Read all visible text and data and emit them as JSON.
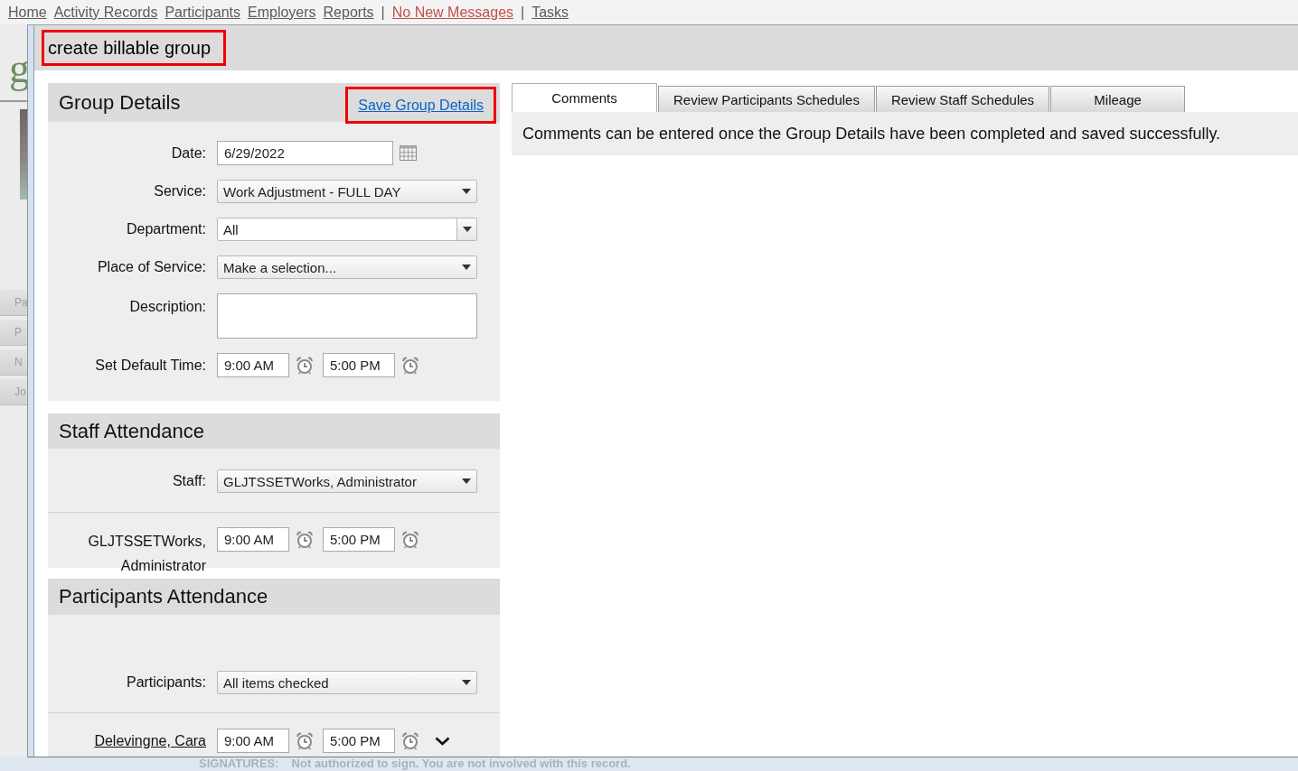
{
  "top_nav": {
    "items": [
      {
        "label": "Home",
        "kind": "link"
      },
      {
        "label": "Activity Records",
        "kind": "link"
      },
      {
        "label": "Participants",
        "kind": "link"
      },
      {
        "label": "Employers",
        "kind": "link"
      },
      {
        "label": "Reports",
        "kind": "link"
      },
      {
        "label": "|",
        "kind": "separator"
      },
      {
        "label": "No New Messages",
        "kind": "alert"
      },
      {
        "label": "|",
        "kind": "separator"
      },
      {
        "label": "Tasks",
        "kind": "link"
      }
    ]
  },
  "background": {
    "logo_fragment": "g",
    "row_fragments": [
      "Pa",
      "P",
      "N",
      "Jo"
    ],
    "signatures": {
      "label": "SIGNATURES:",
      "message": "Not authorized to sign. You are not involved with this record."
    }
  },
  "dialog": {
    "title": "create billable group",
    "title_highlighted": true,
    "group_details": {
      "title": "Group Details",
      "save_link": {
        "label": "Save Group Details",
        "highlighted": true
      },
      "fields": [
        {
          "kind": "date",
          "label": "Date:",
          "value": "6/29/2022"
        },
        {
          "kind": "select",
          "label": "Service:",
          "value": "Work Adjustment - FULL DAY"
        },
        {
          "kind": "combo",
          "label": "Department:",
          "value": "All"
        },
        {
          "kind": "select",
          "label": "Place of Service:",
          "value": "Make a selection..."
        },
        {
          "kind": "textarea",
          "label": "Description:"
        },
        {
          "kind": "time_range",
          "label": "Set Default Time:",
          "start": "9:00 AM",
          "end": "5:00 PM"
        }
      ]
    },
    "staff_attendance": {
      "title": "Staff Attendance",
      "selector": {
        "label": "Staff:",
        "value": "GLJTSSETWorks, Administrator"
      },
      "rows": [
        {
          "name": "GLJTSSETWorks, Administrator",
          "start": "9:00 AM",
          "end": "5:00 PM"
        }
      ]
    },
    "participants_attendance": {
      "title": "Participants Attendance",
      "selector": {
        "label": "Participants:",
        "value": "All items checked"
      },
      "rows": [
        {
          "name": "Delevingne, Cara",
          "start": "9:00 AM",
          "end": "5:00 PM"
        }
      ]
    },
    "tabs": [
      {
        "label": "Comments",
        "selected": true
      },
      {
        "label": "Review Participants Schedules",
        "selected": false
      },
      {
        "label": "Review Staff Schedules",
        "selected": false
      },
      {
        "label": "Mileage",
        "selected": false
      }
    ],
    "tab_content": {
      "message": "Comments can be entered once the Group Details have been completed and saved successfully."
    }
  }
}
